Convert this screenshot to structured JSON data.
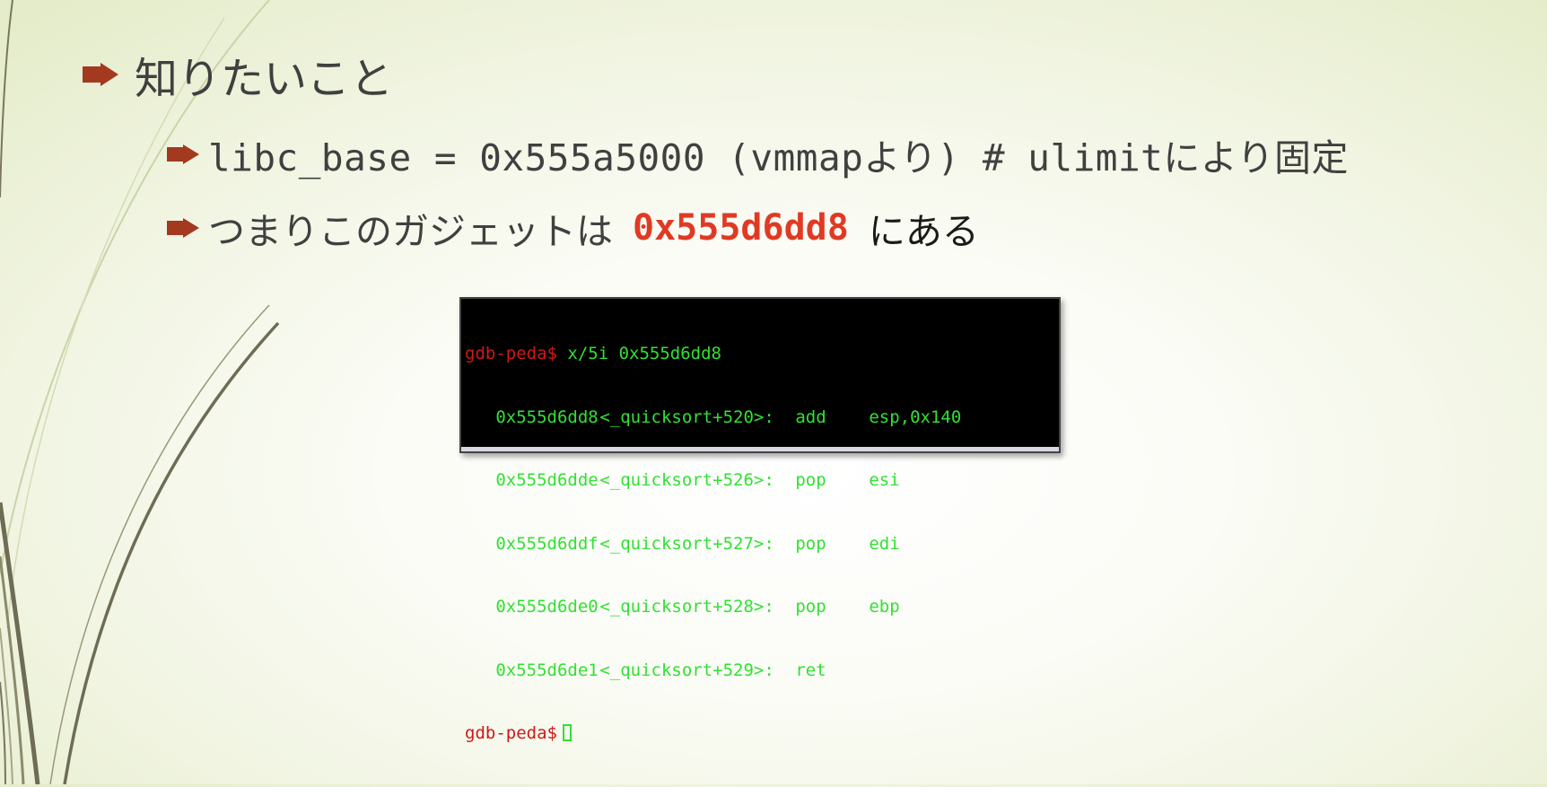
{
  "slide": {
    "heading": "知りたいこと",
    "bullets": {
      "libc_line": "libc_base = 0x555a5000 (vmmapより) # ulimitにより固定",
      "gadget_prefix": "つまりこのガジェットは",
      "gadget_address": "0x555d6dd8",
      "gadget_suffix": "にある"
    },
    "colors": {
      "bullet_arrow": "#a3391f",
      "highlight": "#e03a24",
      "body_text": "#404040"
    }
  },
  "terminal": {
    "prompt": "gdb-peda$",
    "command": "x/5i 0x555d6dd8",
    "lines": [
      {
        "address": "0x555d6dd8",
        "symbol": "<_quicksort+520>:",
        "op": "add",
        "args": "esp,0x140"
      },
      {
        "address": "0x555d6dde",
        "symbol": "<_quicksort+526>:",
        "op": "pop",
        "args": "esi"
      },
      {
        "address": "0x555d6ddf",
        "symbol": "<_quicksort+527>:",
        "op": "pop",
        "args": "edi"
      },
      {
        "address": "0x555d6de0",
        "symbol": "<_quicksort+528>:",
        "op": "pop",
        "args": "ebp"
      },
      {
        "address": "0x555d6de1",
        "symbol": "<_quicksort+529>:",
        "op": "ret",
        "args": ""
      }
    ],
    "end_prompt": "gdb-peda$",
    "colors": {
      "text": "#33e033",
      "prompt": "#d01818",
      "background": "#000000"
    }
  }
}
